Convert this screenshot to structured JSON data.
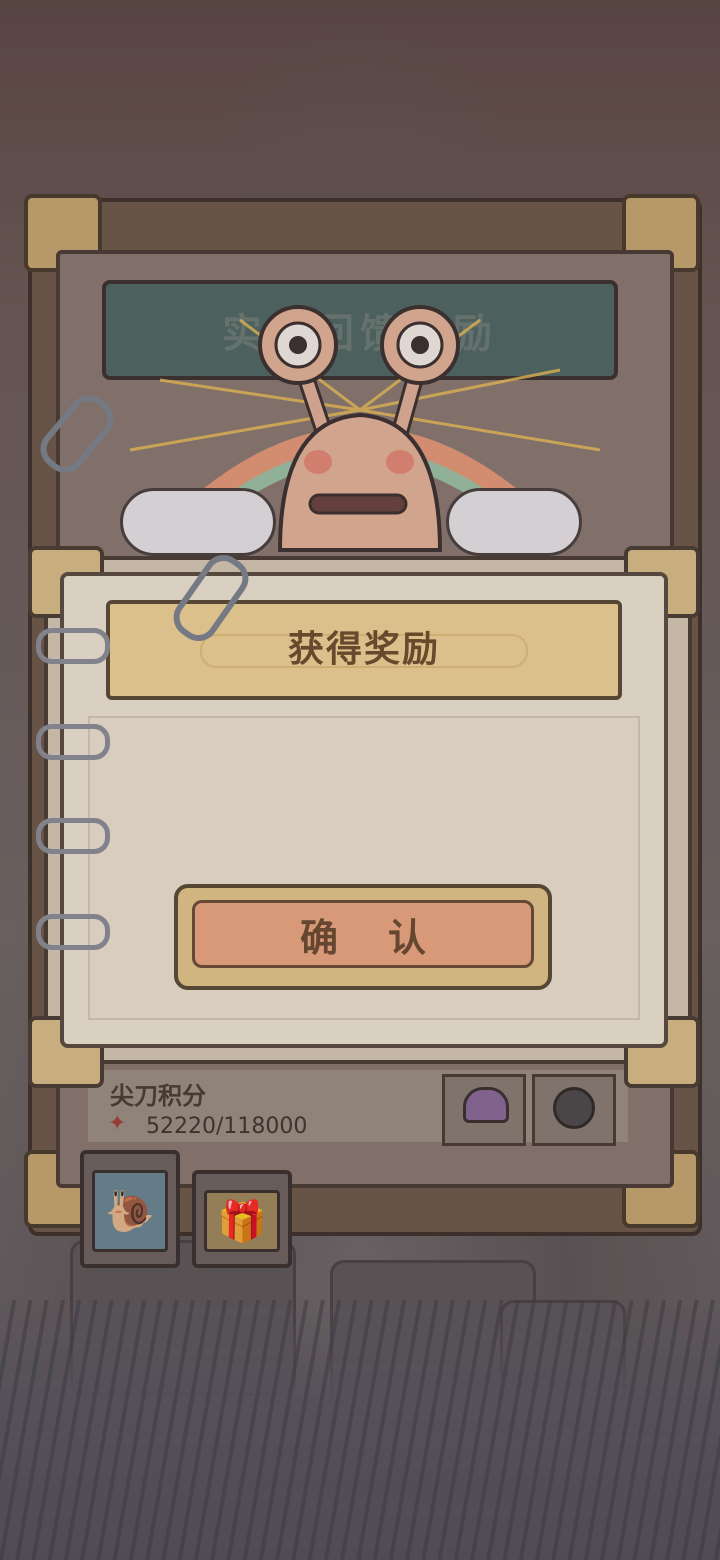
{
  "background_board": {
    "banner_title": "实名回馈奖励",
    "footer_label": "尖刀积分",
    "score_text": "52220/118000",
    "tabs": [
      {
        "name": "snail-tab",
        "icon": "snail-icon"
      },
      {
        "name": "gift-tab",
        "icon": "gift-box-icon"
      }
    ]
  },
  "dialog": {
    "title": "获得奖励",
    "confirm_label": "确认"
  },
  "colors": {
    "paper": "#efe7d6",
    "title_banner": "#f3d59a",
    "confirm_button": "#eea983",
    "frame": "#4b3e35"
  }
}
